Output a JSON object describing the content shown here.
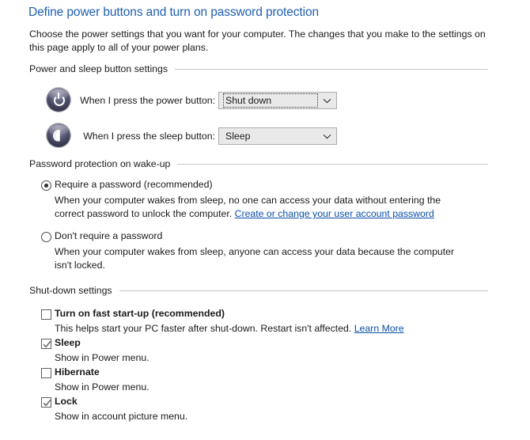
{
  "page": {
    "title": "Define power buttons and turn on password protection",
    "description": "Choose the power settings that you want for your computer. The changes that you make to the settings on this page apply to all of your power plans.",
    "title_color": "#1f5fb0",
    "link_color": "#0b4fa8"
  },
  "power_section": {
    "label": "Power and sleep button settings",
    "rows": [
      {
        "icon": "power-button-icon",
        "label": "When I press the power button:",
        "value": "Shut down",
        "focused": true
      },
      {
        "icon": "sleep-moon-icon",
        "label": "When I press the sleep button:",
        "value": "Sleep",
        "focused": false
      }
    ]
  },
  "password_section": {
    "label": "Password protection on wake-up",
    "options": [
      {
        "title": "Require a password (recommended)",
        "selected": true,
        "description_before": "When your computer wakes from sleep, no one can access your data without entering the correct password to unlock the computer. ",
        "link_text": "Create or change your user account password",
        "description_after": ""
      },
      {
        "title": "Don't require a password",
        "selected": false,
        "description_before": "When your computer wakes from sleep, anyone can access your data because the computer isn't locked.",
        "link_text": "",
        "description_after": ""
      }
    ]
  },
  "shutdown_section": {
    "label": "Shut-down settings",
    "items": [
      {
        "title": "Turn on fast start-up (recommended)",
        "checked": false,
        "description_before": "This helps start your PC faster after shut-down. Restart isn't affected. ",
        "link_text": "Learn More",
        "description_after": ""
      },
      {
        "title": "Sleep",
        "checked": true,
        "description_before": "Show in Power menu.",
        "link_text": "",
        "description_after": ""
      },
      {
        "title": "Hibernate",
        "checked": false,
        "description_before": "Show in Power menu.",
        "link_text": "",
        "description_after": ""
      },
      {
        "title": "Lock",
        "checked": true,
        "description_before": "Show in account picture menu.",
        "link_text": "",
        "description_after": ""
      }
    ]
  }
}
